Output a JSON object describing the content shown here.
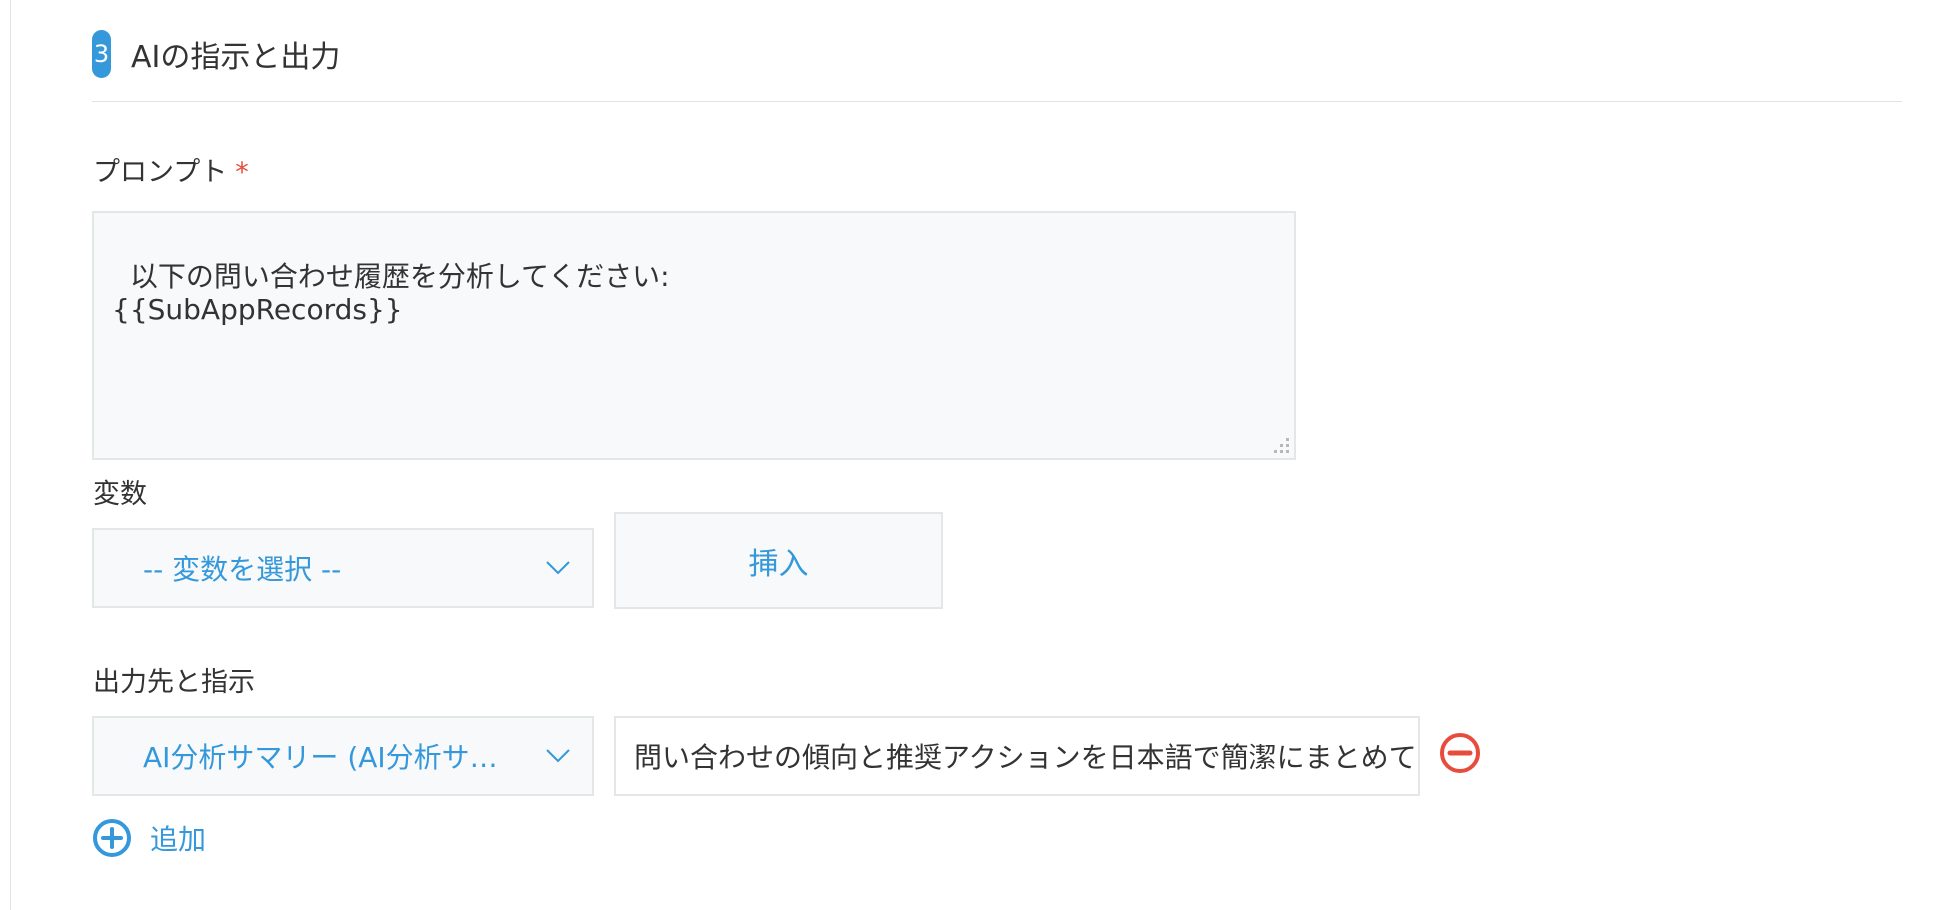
{
  "section": {
    "step_number": "3",
    "title": "AIの指示と出力"
  },
  "prompt": {
    "label": "プロンプト",
    "required_mark": "*",
    "value": "以下の問い合わせ履歴を分析してください:\n{{SubAppRecords}}"
  },
  "variables": {
    "label": "変数",
    "select_value": "-- 変数を選択 --",
    "insert_label": "挿入"
  },
  "output": {
    "label": "出力先と指示",
    "select_value": "AI分析サマリー (AI分析サ…",
    "instruction_value": "問い合わせの傾向と推奨アクションを日本語で簡潔にまとめて",
    "add_label": "追加"
  },
  "colors": {
    "accent": "#3498db",
    "danger": "#e74c3c",
    "border": "#e3e7e8",
    "field_background": "#f7f9fa",
    "text": "#333333"
  },
  "icons": {
    "dropdown": "chevron-down-icon",
    "remove": "minus-circle-icon",
    "add": "plus-circle-icon",
    "resize": "resize-grip-icon"
  }
}
